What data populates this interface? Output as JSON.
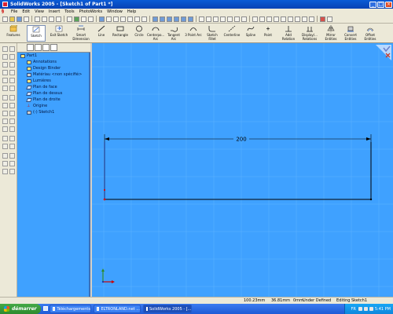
{
  "window": {
    "title": "SolidWorks 2005 - [Sketch1 of Part1 *]",
    "controls": [
      "minimize",
      "maximize",
      "close"
    ]
  },
  "menu": [
    "File",
    "Edit",
    "View",
    "Insert",
    "Tools",
    "PhotoWorks",
    "Window",
    "Help"
  ],
  "command_manager": {
    "left_buttons": [
      {
        "label": "Features",
        "icon": "features-icon"
      },
      {
        "label": "Sketch",
        "icon": "sketch-icon",
        "active": true
      },
      {
        "label": "Exit Sketch",
        "icon": "exit-sketch-icon"
      },
      {
        "label": "Smart Dimension",
        "icon": "smart-dimension-icon"
      }
    ],
    "tools": [
      {
        "label": "Line",
        "icon": "line-icon"
      },
      {
        "label": "Rectangle",
        "icon": "rectangle-icon"
      },
      {
        "label": "Circle",
        "icon": "circle-icon"
      },
      {
        "label": "Centerpo... Arc",
        "icon": "centerpoint-arc-icon"
      },
      {
        "label": "Tangent Arc",
        "icon": "tangent-arc-icon"
      },
      {
        "label": "3 Point Arc",
        "icon": "three-point-arc-icon"
      },
      {
        "label": "Sketch Fillet",
        "icon": "sketch-fillet-icon"
      },
      {
        "label": "Centerline",
        "icon": "centerline-icon"
      },
      {
        "label": "Spline",
        "icon": "spline-icon"
      },
      {
        "label": "Point",
        "icon": "point-icon"
      },
      {
        "label": "Add Relation",
        "icon": "add-relation-icon"
      },
      {
        "label": "Display/... Relations",
        "icon": "display-relations-icon"
      },
      {
        "label": "Mirror Entities",
        "icon": "mirror-entities-icon"
      },
      {
        "label": "Convert Entities",
        "icon": "convert-entities-icon"
      },
      {
        "label": "Offset Entities",
        "icon": "offset-entities-icon"
      }
    ]
  },
  "feature_tree": [
    {
      "label": "Part1",
      "icon": "part-icon"
    },
    {
      "label": "Annotations",
      "icon": "annotations-icon"
    },
    {
      "label": "Design Binder",
      "icon": "design-binder-icon"
    },
    {
      "label": "Matériau <non spécifié>",
      "icon": "material-icon"
    },
    {
      "label": "Lumières",
      "icon": "lights-icon"
    },
    {
      "label": "Plan de face",
      "icon": "plane-icon"
    },
    {
      "label": "Plan de dessus",
      "icon": "plane-icon"
    },
    {
      "label": "Plan de droite",
      "icon": "plane-icon"
    },
    {
      "label": "Origine",
      "icon": "origin-icon"
    },
    {
      "label": "(-) Sketch1",
      "icon": "sketch-icon"
    }
  ],
  "viewport": {
    "background": "#3fa1ff",
    "dimension_value": "200"
  },
  "status": {
    "x": "100.23mm",
    "y": "36.81mm",
    "z": "0mm",
    "state": "Under Defined",
    "mode": "Editing Sketch1"
  },
  "taskbar": {
    "start": "démarrer",
    "tasks": [
      {
        "label": "Téléchargements"
      },
      {
        "label": "ELTRONLAND.net ..."
      },
      {
        "label": "SolidWorks 2005 - [...",
        "active": true
      }
    ],
    "lang": "FR",
    "clock": "5:41 PM"
  }
}
